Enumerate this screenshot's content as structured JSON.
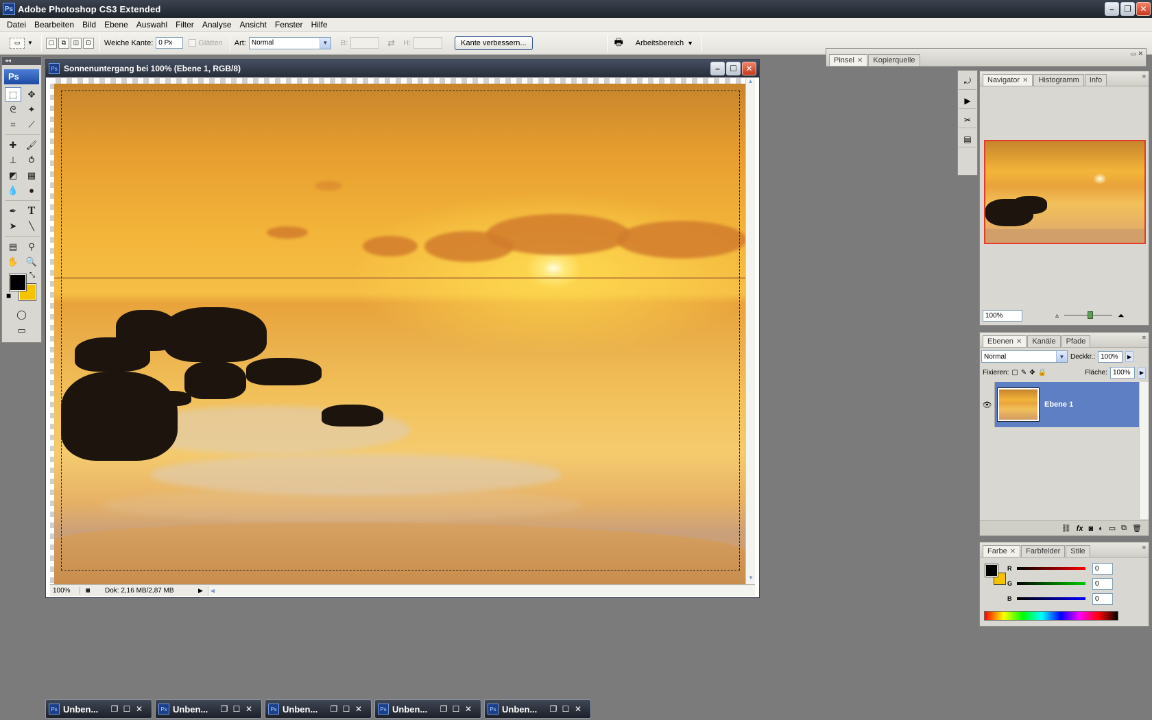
{
  "app": {
    "title": "Adobe Photoshop CS3 Extended",
    "logo": "Ps"
  },
  "menu": [
    "Datei",
    "Bearbeiten",
    "Bild",
    "Ebene",
    "Auswahl",
    "Filter",
    "Analyse",
    "Ansicht",
    "Fenster",
    "Hilfe"
  ],
  "options": {
    "feather_label": "Weiche Kante:",
    "feather_value": "0 Px",
    "antialias_label": "Glätten",
    "style_label": "Art:",
    "style_value": "Normal",
    "width_label": "B:",
    "height_label": "H:",
    "refine_edge": "Kante verbessern...",
    "workspace": "Arbeitsbereich"
  },
  "toolbox": {
    "logo": "Ps",
    "fg_color": "#000000",
    "bg_color": "#f5c400"
  },
  "document": {
    "title": "Sonnenuntergang bei 100% (Ebene 1, RGB/8)",
    "zoom": "100%",
    "doc_info": "Dok: 2,16 MB/2,87 MB"
  },
  "brush_dock": {
    "tabs": [
      "Pinsel",
      "Kopierquelle"
    ]
  },
  "navigator": {
    "tabs": [
      "Navigator",
      "Histogramm",
      "Info"
    ],
    "zoom": "100%",
    "frame_color": "#e63a2a"
  },
  "layers": {
    "tabs": [
      "Ebenen",
      "Kanäle",
      "Pfade"
    ],
    "blend_mode": "Normal",
    "opacity_label": "Deckkr.:",
    "opacity_value": "100%",
    "lock_label": "Fixieren:",
    "fill_label": "Fläche:",
    "fill_value": "100%",
    "layer_name": "Ebene 1",
    "selected_color": "#5f7fc4"
  },
  "color": {
    "tabs": [
      "Farbe",
      "Farbfelder",
      "Stile"
    ],
    "r_label": "R",
    "r_value": "0",
    "g_label": "G",
    "g_value": "0",
    "b_label": "B",
    "b_value": "0"
  },
  "minimized_docs": [
    {
      "label": "Unben..."
    },
    {
      "label": "Unben..."
    },
    {
      "label": "Unben..."
    },
    {
      "label": "Unben..."
    },
    {
      "label": "Unben..."
    }
  ]
}
